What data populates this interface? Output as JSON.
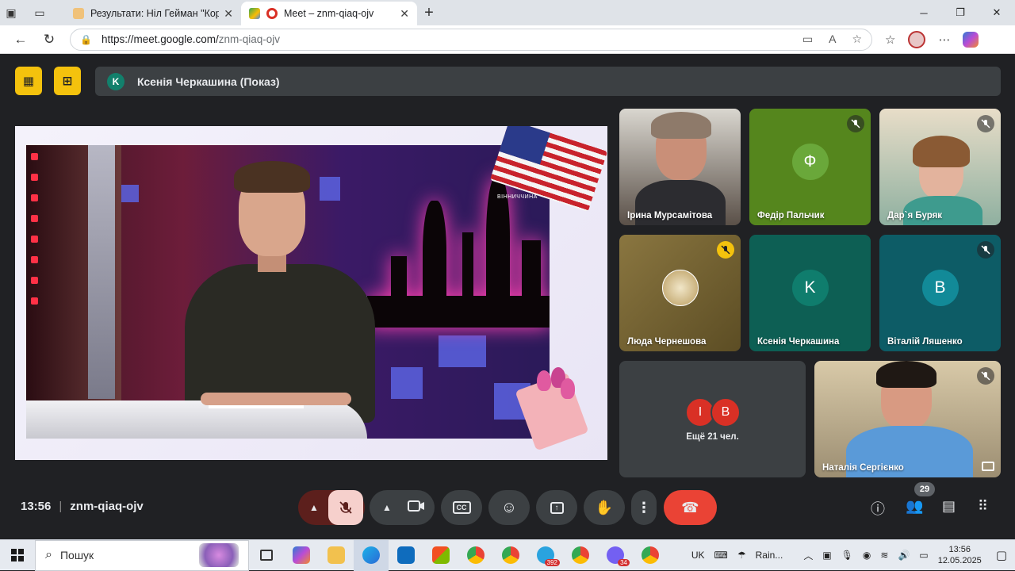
{
  "browser": {
    "tabs": [
      {
        "title": "Результати: Ніл Гейман \"Кораліна\"",
        "active": false
      },
      {
        "title": "Meet – znm-qiaq-ojv",
        "active": true
      }
    ],
    "url_host": "https://meet.google.com/",
    "url_path": "znm-qiaq-ojv"
  },
  "meet": {
    "presenter": {
      "initial": "K",
      "label": "Ксенія Черкашина (Показ)"
    },
    "stage": {
      "flag_caption": "ВІННИЧЧИНА"
    },
    "tiles": [
      {
        "name": "Ірина Мурсамітова",
        "type": "camera",
        "muted": false
      },
      {
        "name": "Федір Пальчик",
        "type": "avatar",
        "initial": "Ф",
        "color": "#4f9a2b",
        "muted": true
      },
      {
        "name": "Дар`я Буряк",
        "type": "camera",
        "muted": true
      },
      {
        "name": "Люда Чернешова",
        "type": "image",
        "muted": true
      },
      {
        "name": "Ксенія Черкашина",
        "type": "avatar",
        "initial": "K",
        "color": "#0f7d6d",
        "muted": false
      },
      {
        "name": "Віталій Ляшенко",
        "type": "avatar",
        "initial": "B",
        "color": "#137d8a",
        "muted": true
      },
      {
        "name": "Наталія Сергієнко",
        "type": "camera",
        "muted": true
      }
    ],
    "more": {
      "initials": [
        "І",
        "B"
      ],
      "label": "Ещё 21 чел."
    },
    "meeting_time": "13:56",
    "meeting_code": "znm-qiaq-ojv",
    "participants_count": "29"
  },
  "taskbar": {
    "search_placeholder": "Пошук",
    "badges": {
      "telegram": "392",
      "viber": "34"
    },
    "lang": "UK",
    "weather": "Rain...",
    "time": "13:56",
    "date": "12.05.2025"
  },
  "colors": {
    "accent_yellow": "#f4c20d",
    "hangup_red": "#ea4335",
    "meet_bg": "#202124"
  }
}
